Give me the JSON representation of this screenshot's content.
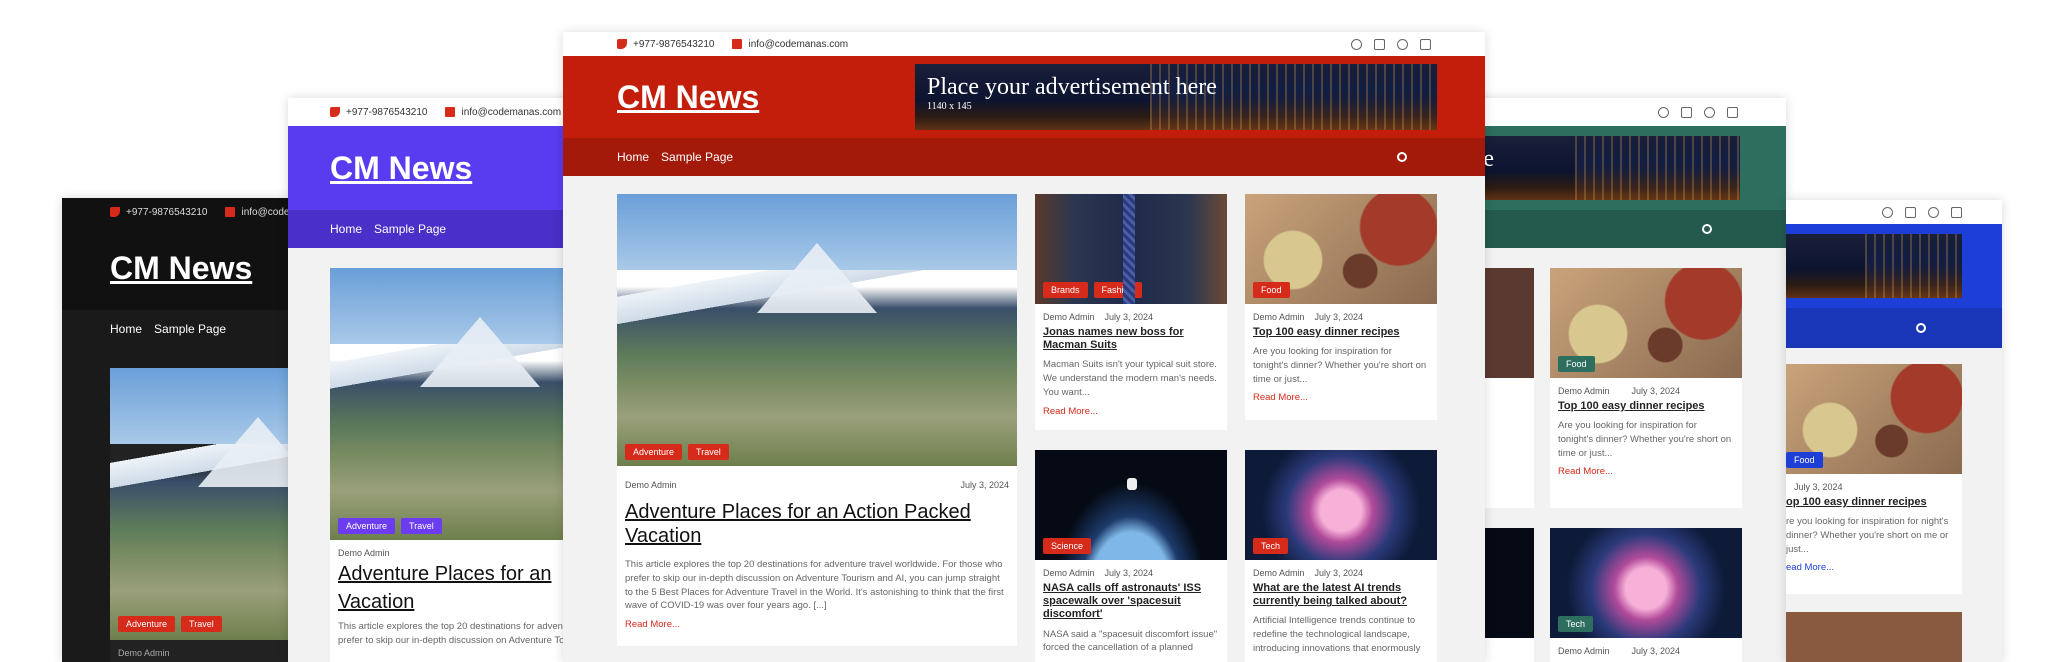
{
  "site": {
    "phone": "+977-9876543210",
    "email": "info@codemanas.com",
    "email_short": "info@codem",
    "brand": "CM News",
    "ad_line1": "Place your advertisement here",
    "ad_line2": "1140 x 145",
    "ad_partial": "t here"
  },
  "nav": {
    "home": "Home",
    "sample": "Sample Page"
  },
  "colors": {
    "red": "#c31e0b",
    "red_dark": "#a31a0a",
    "purple": "#5a3cf0",
    "purple_dark": "#4a2fc8",
    "black": "#111111",
    "teal": "#2d6e5e",
    "blue": "#1d3fd8",
    "badge_red": "#d62a1a",
    "badge_purple": "#6b3cf0",
    "badge_teal": "#2d6e5e",
    "badge_blue": "#1d3fd8"
  },
  "author": "Demo Admin",
  "date": "July 3, 2024",
  "read_more": "Read More...",
  "posts": {
    "featured": {
      "tags": [
        "Adventure",
        "Travel"
      ],
      "title": "Adventure Places for an Action Packed Vacation",
      "title_partial": "Adventure Places for an",
      "title_line2": "Vacation",
      "excerpt": "This article explores the top 20 destinations for adventure travel worldwide. For those who prefer to skip our in-depth discussion on Adventure Tourism and AI, you can jump straight to the 5 Best Places for Adventure Travel in the World. It's astonishing to think that the first wave of COVID-19 was over four years ago. [...]",
      "excerpt_partial": "This article explores the top 20 destinations for adven prefer to skip our in-depth discussion on Adventure To"
    },
    "jonas": {
      "tags": [
        "Brands",
        "Fashion"
      ],
      "title": "Jonas names new boss for Macman Suits",
      "excerpt": "Macman Suits isn't your typical suit store. We understand the modern man's needs. You want..."
    },
    "dinner": {
      "tags": [
        "Food"
      ],
      "title": "Top 100 easy dinner recipes",
      "excerpt": "Are you looking for inspiration for tonight's dinner? Whether you're short on time or just...",
      "title_partial": "op 100 easy dinner recipes",
      "excerpt_partial": "re you looking for inspiration for night's dinner? Whether you're short on me or just..."
    },
    "nasa": {
      "tags": [
        "Science"
      ],
      "title": "NASA calls off astronauts' ISS spacewalk over 'spacesuit discomfort'",
      "excerpt": "NASA said a \"spacesuit discomfort issue\" forced the cancellation of a planned"
    },
    "ai": {
      "tags": [
        "Tech"
      ],
      "title": "What are the latest AI trends currently being talked about?",
      "excerpt": "Artificial Intelligence trends continue to redefine the technological landscape, introducing innovations that enormously"
    }
  },
  "fragments": {
    "left_excerpt": "uit",
    "left_excerpt2": "n man's",
    "ad_read": "ead More..."
  }
}
